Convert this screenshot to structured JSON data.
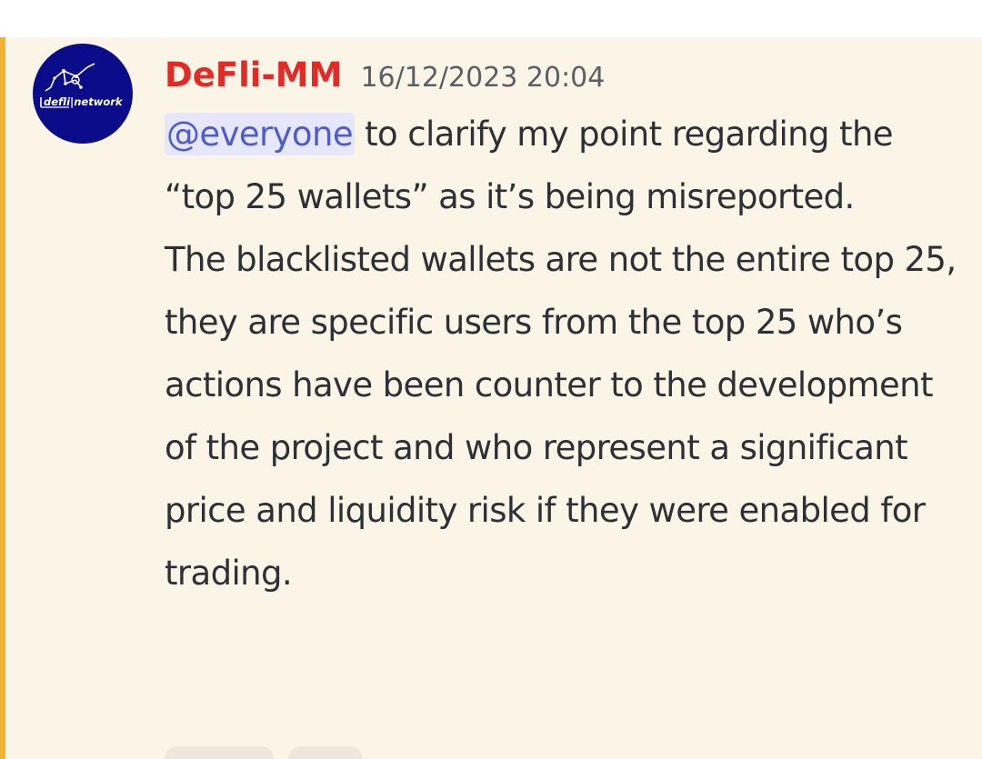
{
  "message": {
    "author": "DeFli-MM",
    "timestamp": "16/12/2023 20:04",
    "avatar_text": "defli|network",
    "mention": "@everyone",
    "paragraph_1_rest": " to clarify my point regarding the “top 25 wallets” as it’s being misreported.",
    "paragraph_2": "The blacklisted wallets are not the entire top 25, they are specific users from the top 25 who’s actions have been counter to the development of the project and who represent a significant price and liquidity risk if they were enabled for trading."
  },
  "colors": {
    "author": "#e22b27",
    "mention_bar": "#f0b232",
    "mention_bg": "#e6e7fb",
    "mention_text": "#4e5cc6",
    "message_bg": "#fbf5e8",
    "avatar_bg": "#0a0c8a"
  },
  "icons": {
    "avatar": "defli-network-logo"
  }
}
